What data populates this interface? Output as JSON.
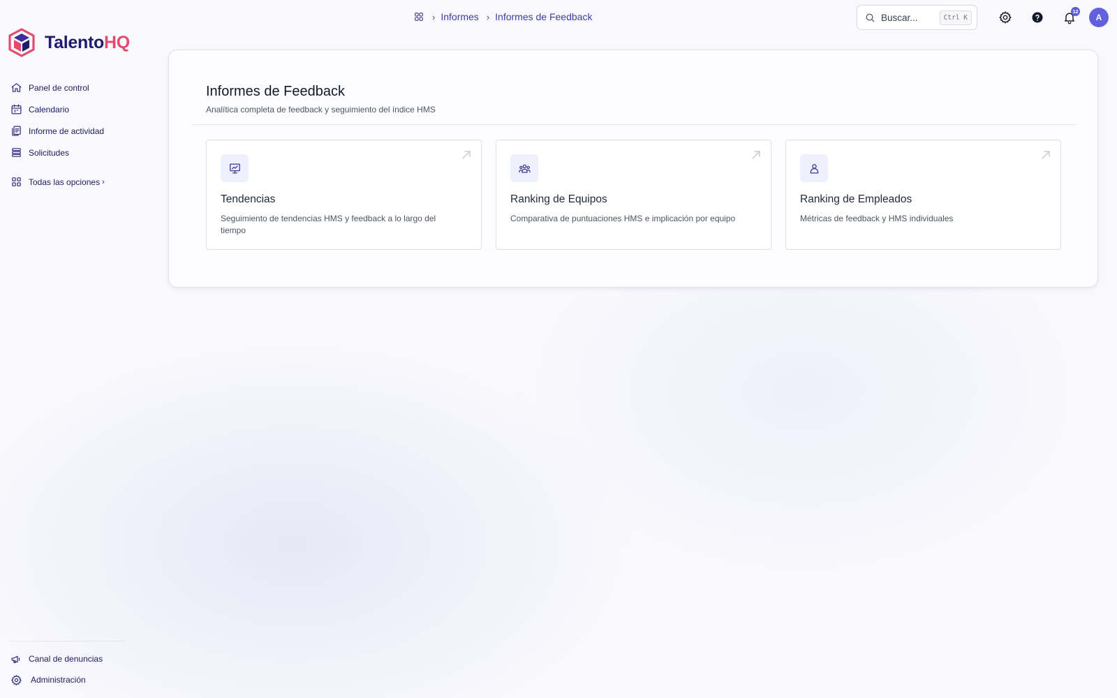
{
  "brand": {
    "name_part1": "Talento",
    "name_part2": "HQ",
    "primary_color": "#1e1b6e",
    "accent_color": "#e5496d"
  },
  "sidebar": {
    "items": [
      {
        "label": "Panel de control",
        "icon": "home-icon"
      },
      {
        "label": "Calendario",
        "icon": "calendar-icon"
      },
      {
        "label": "Informe de actividad",
        "icon": "report-icon"
      },
      {
        "label": "Solicitudes",
        "icon": "list-icon"
      }
    ],
    "all_options": {
      "label": "Todas las opciones",
      "icon": "grid-icon"
    },
    "bottom_items": [
      {
        "label": "Canal de denuncias",
        "icon": "megaphone-icon"
      },
      {
        "label": "Administración",
        "icon": "gear-icon"
      }
    ]
  },
  "breadcrumb": {
    "items": [
      "Informes",
      "Informes de Feedback"
    ]
  },
  "search": {
    "placeholder": "Buscar...",
    "shortcut": "Ctrl K"
  },
  "header": {
    "notification_count": "12",
    "avatar_initial": "A",
    "avatar_color": "#6161e0"
  },
  "main": {
    "title": "Informes de Feedback",
    "subtitle": "Analítica completa de feedback y seguimiento del índice HMS",
    "cards": [
      {
        "title": "Tendencias",
        "description": "Seguimiento de tendencias HMS y feedback a lo largo del tiempo",
        "icon": "presentation-chart-icon"
      },
      {
        "title": "Ranking de Equipos",
        "description": "Comparativa de puntuaciones HMS e implicación por equipo",
        "icon": "team-icon"
      },
      {
        "title": "Ranking de Empleados",
        "description": "Métricas de feedback y HMS individuales",
        "icon": "user-icon"
      }
    ]
  }
}
